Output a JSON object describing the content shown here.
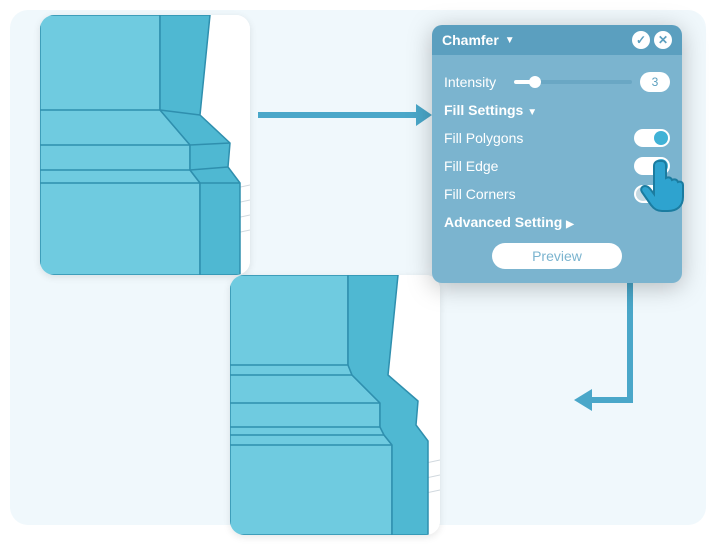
{
  "panel": {
    "title": "Chamfer",
    "intensity_label": "Intensity",
    "intensity_value": "3",
    "section_fill": "Fill Settings",
    "fill_polygons": "Fill Polygons",
    "fill_edge": "Fill Edge",
    "fill_corners": "Fill Corners",
    "toggles": {
      "polygons": true,
      "edge": true,
      "corners": false
    },
    "section_advanced": "Advanced Setting",
    "preview_label": "Preview"
  },
  "icons": {
    "confirm": "✓",
    "cancel": "✕",
    "dropdown": "▼",
    "expand": "▶"
  },
  "thumbs": {
    "before": "model-before-chamfer",
    "after": "model-after-chamfer"
  }
}
